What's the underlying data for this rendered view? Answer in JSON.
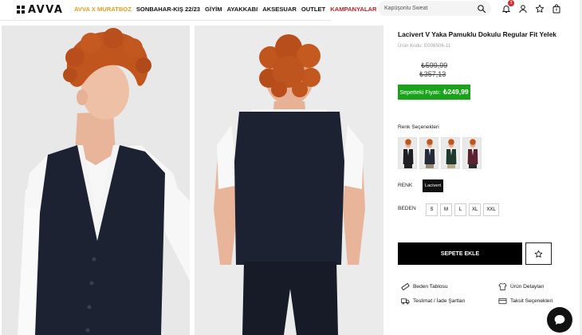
{
  "header": {
    "logo_text": "AVVA",
    "nav": [
      {
        "label": "AVVA X MURATBOZ",
        "kind": "collab"
      },
      {
        "label": "SONBAHAR-KIŞ 22/23",
        "kind": "normal"
      },
      {
        "label": "GİYİM",
        "kind": "normal"
      },
      {
        "label": "AYAKKABI",
        "kind": "normal"
      },
      {
        "label": "AKSESUAR",
        "kind": "normal"
      },
      {
        "label": "OUTLET",
        "kind": "normal"
      },
      {
        "label": "KAMPANYALAR",
        "kind": "campaign"
      }
    ],
    "search_placeholder": "Kapüşonlu Sweat",
    "notification_count": "3",
    "icons": [
      "bell-icon",
      "user-icon",
      "star-icon",
      "bag-icon"
    ]
  },
  "product": {
    "title": "Lacivert V Yaka Pamuklu Dokulu Regular Fit Yelek",
    "code": "Ürün Kodu: E006506-11",
    "old_price": "₺599,99",
    "discounted_price": "₺357,13",
    "basket_price_label": "Sepetteki Fiyatı:",
    "basket_price": "₺249,99",
    "color_heading": "Renk Seçenekleri",
    "color_options": [
      {
        "name": "black",
        "vest": "#1d1f22",
        "shirt": "#ffffff"
      },
      {
        "name": "navy",
        "vest": "#262b3a",
        "shirt": "#ffffff"
      },
      {
        "name": "green",
        "vest": "#1f3a2d",
        "shirt": "#ffffff"
      },
      {
        "name": "burgundy",
        "vest": "#5b2230",
        "shirt": "#ffffff"
      }
    ],
    "renk_label": "RENK",
    "selected_color": "Lacivert",
    "beden_label": "BEDEN",
    "sizes": [
      "S",
      "M",
      "L",
      "XL",
      "XXL"
    ],
    "add_to_cart": "SEPETE EKLE",
    "links": {
      "size_chart": "Beden Tablosu",
      "product_details": "Ürün Detayları",
      "delivery": "Teslimat / İade Şartları",
      "installments": "Taksit Seçenekleri"
    }
  },
  "colors": {
    "collab": "#e0a020",
    "campaign": "#c0202a",
    "basket_green": "#1aa31a",
    "badge_red": "#d8262b",
    "vest_navy": "#1c2232"
  }
}
